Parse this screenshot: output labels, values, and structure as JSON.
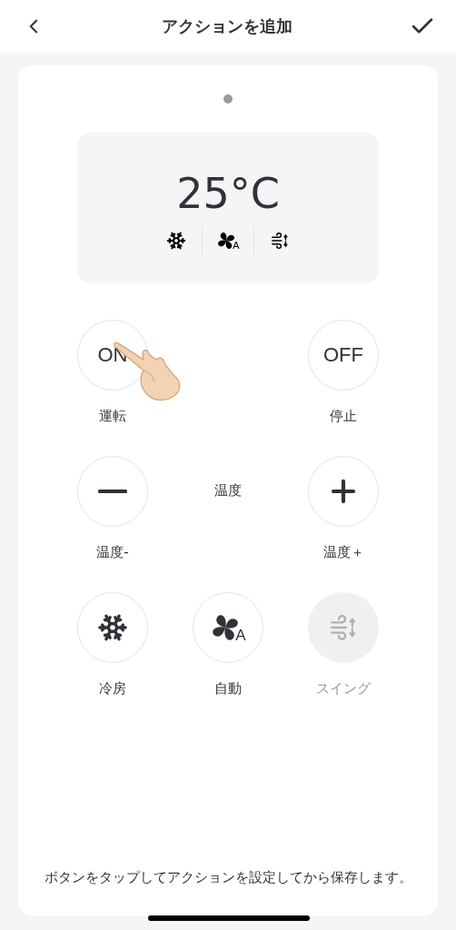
{
  "header": {
    "title": "アクションを追加"
  },
  "display": {
    "temperature": "25°C",
    "mode_icons": [
      {
        "kind": "cool"
      },
      {
        "kind": "fan_auto",
        "badge": "A"
      },
      {
        "kind": "swing"
      }
    ]
  },
  "button_rows": [
    [
      {
        "kind": "text",
        "face": "ON",
        "label": "運転",
        "disabled": false
      },
      {
        "kind": "blank"
      },
      {
        "kind": "text",
        "face": "OFF",
        "label": "停止",
        "disabled": false
      }
    ],
    [
      {
        "kind": "minus",
        "label": "温度-",
        "disabled": false
      },
      {
        "kind": "caption",
        "label": "温度"
      },
      {
        "kind": "plus",
        "label": "温度＋",
        "disabled": false
      }
    ],
    [
      {
        "kind": "cool",
        "label": "冷房",
        "disabled": false
      },
      {
        "kind": "fan_auto",
        "badge": "A",
        "label": "自動",
        "disabled": false
      },
      {
        "kind": "swing",
        "label": "スイング",
        "disabled": true
      }
    ]
  ],
  "hint": "ボタンをタップしてアクションを設定してから保存します。"
}
